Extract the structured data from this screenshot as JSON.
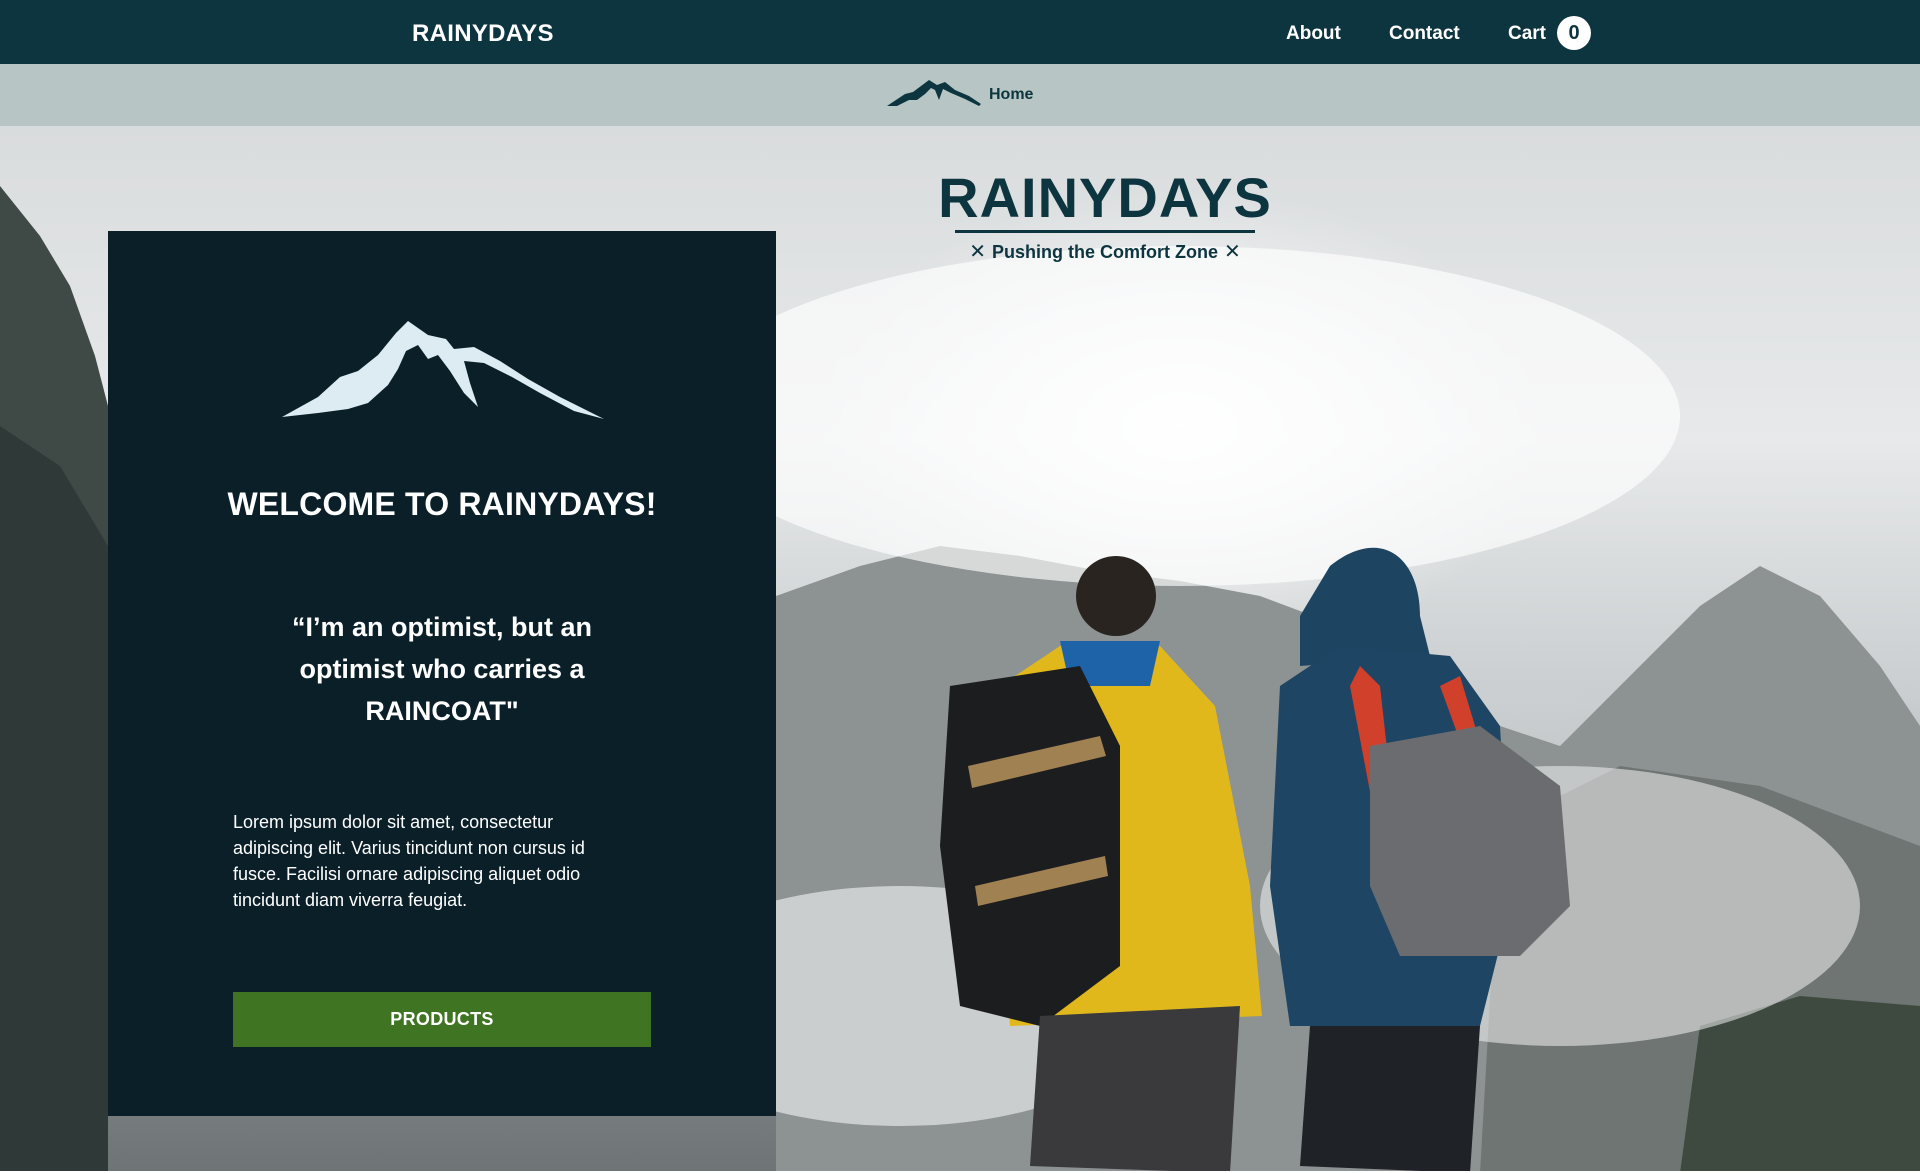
{
  "nav": {
    "brand": "RAINYDAYS",
    "links": [
      {
        "label": "About"
      },
      {
        "label": "Contact"
      },
      {
        "label": "Cart"
      }
    ],
    "cart_count": "0"
  },
  "breadcrumb": {
    "icon": "mountain-icon",
    "home_label": "Home"
  },
  "hero": {
    "logo_title": "RAINYDAYS",
    "logo_tagline": "Pushing the Comfort Zone",
    "tagline_icon": "x-cross-icon"
  },
  "card": {
    "icon": "mountain-icon",
    "title": "WELCOME TO RAINYDAYS!",
    "quote": "“I’m an optimist, but an optimist who carries a RAINCOAT\"",
    "body": "Lorem ipsum dolor sit amet, consectetur adipiscing elit. Varius tincidunt non cursus id fusce. Facilisi ornare adipiscing aliquet odio tincidunt diam viverra feugiat.",
    "button_label": "PRODUCTS"
  },
  "colors": {
    "nav_bg": "#0d3540",
    "breadcrumb_bg": "#b7c6c5",
    "card_bg": "#0a1f27",
    "button_bg": "#3f7422",
    "logo_text": "#0d3540"
  }
}
